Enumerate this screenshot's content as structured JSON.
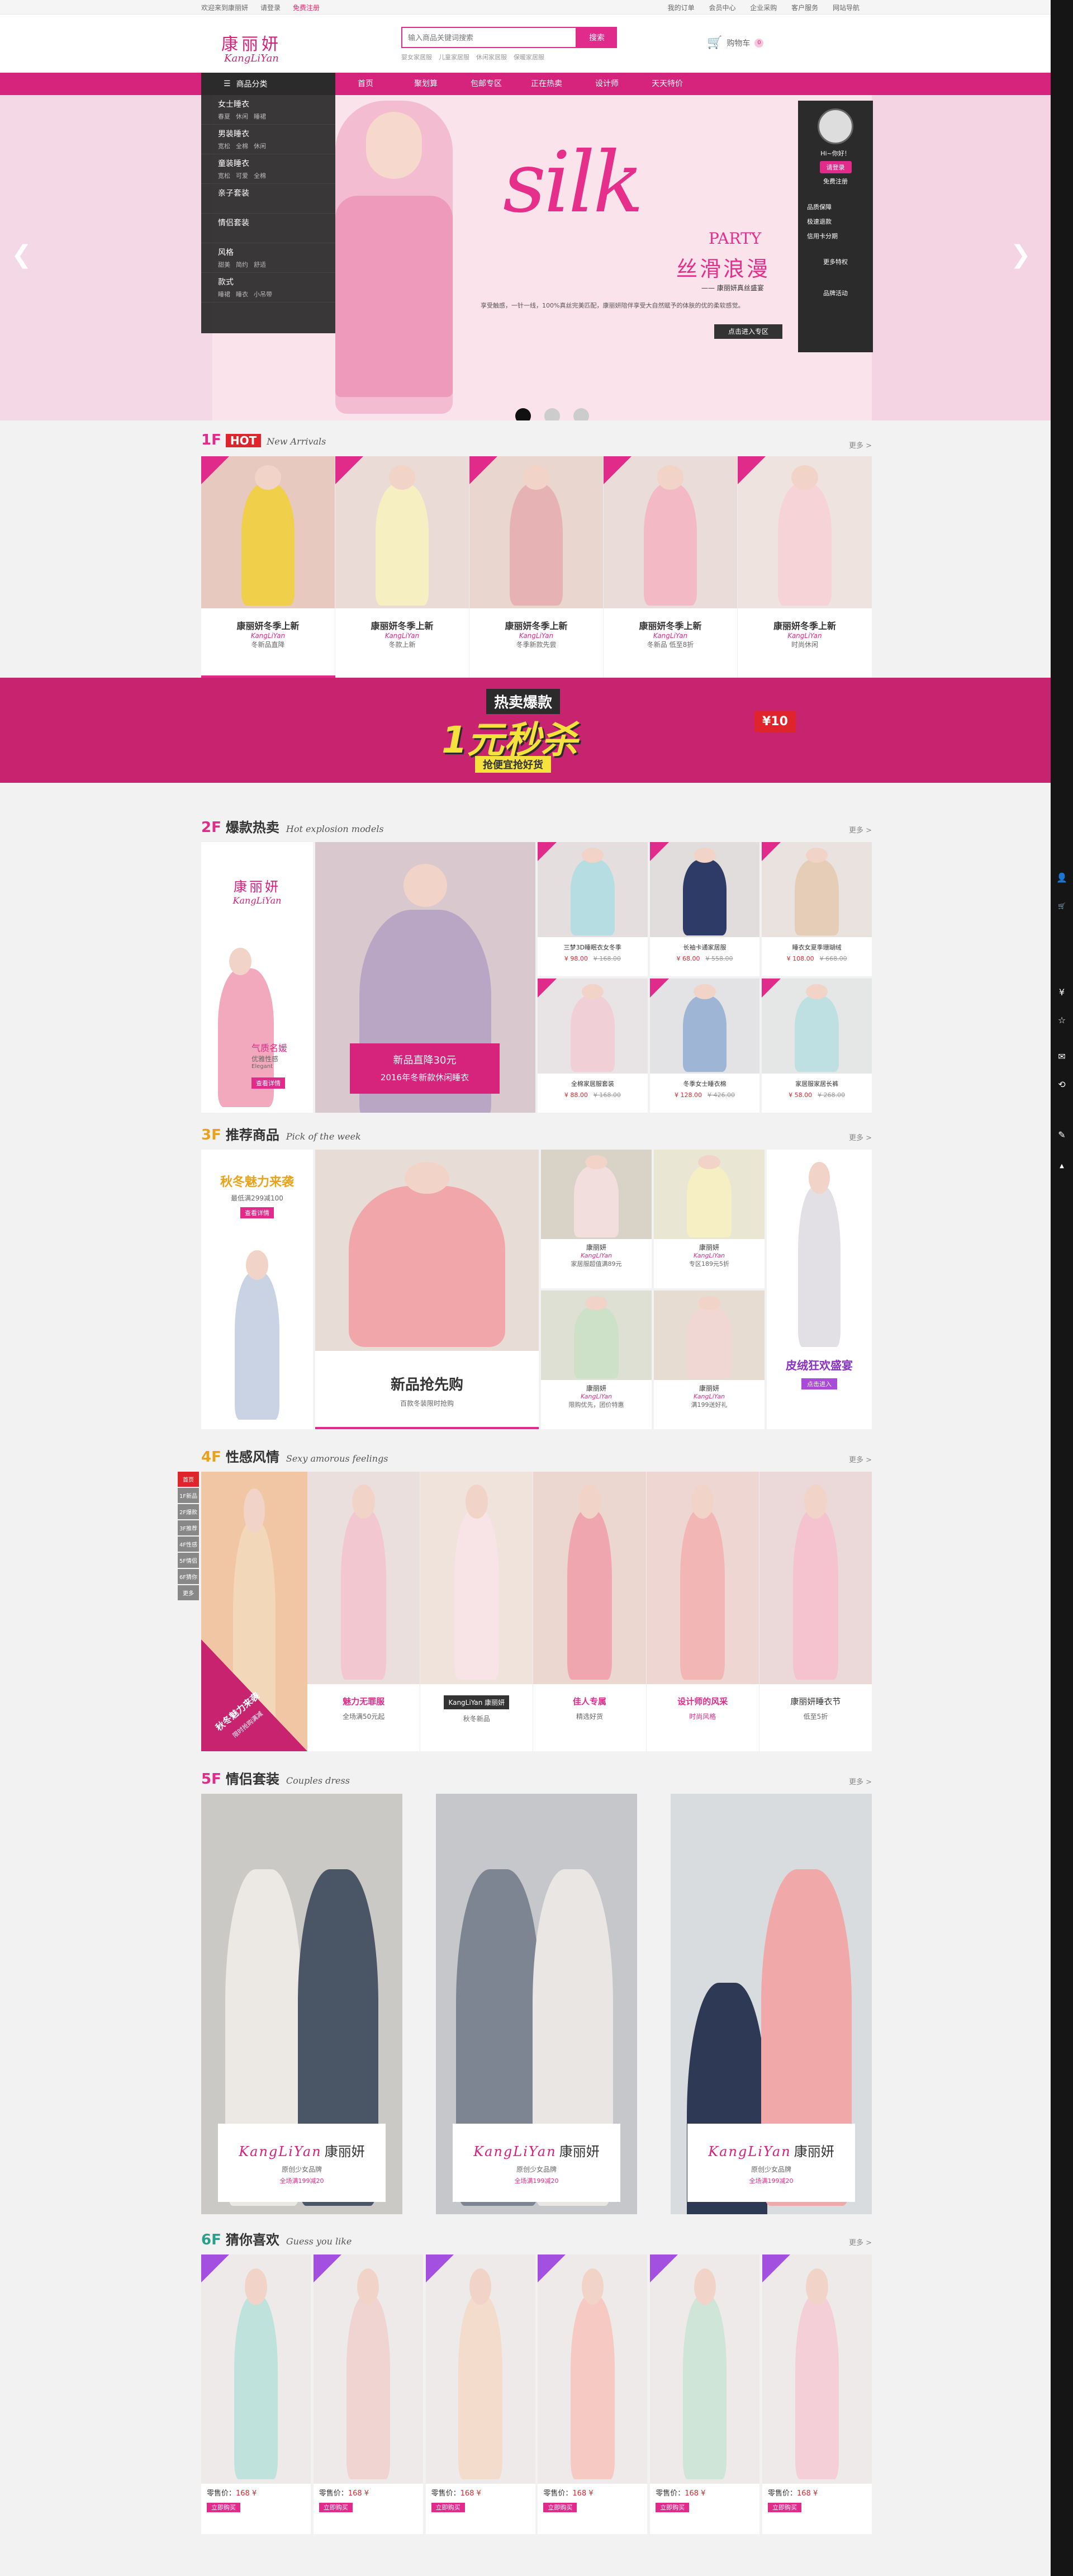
{
  "topbar": {
    "welcome": "欢迎来到康丽妍",
    "login": "请登录",
    "register": "免费注册",
    "links": [
      "我的订单",
      "会员中心",
      "企业采购",
      "客户服务",
      "网站导航"
    ]
  },
  "header": {
    "logo_cn": "康丽妍",
    "logo_en": "KangLiYan",
    "search_placeholder": "输入商品关键词搜索",
    "search_btn": "搜索",
    "hot": [
      "婴女家居服",
      "儿童家居服",
      "休闲家居服",
      "保暖家居服"
    ],
    "cart_label": "购物车",
    "cart_count": "0"
  },
  "nav": {
    "category": "商品分类",
    "items": [
      "首页",
      "聚划算",
      "包邮专区",
      "正在热卖",
      "设计师",
      "天天特价"
    ]
  },
  "catmenu": [
    {
      "t": "女士睡衣",
      "s": [
        "春夏",
        "休闲",
        "睡裙"
      ]
    },
    {
      "t": "男装睡衣",
      "s": [
        "宽松",
        "全棉",
        "休闲"
      ]
    },
    {
      "t": "童装睡衣",
      "s": [
        "宽松",
        "可爱",
        "全棉"
      ]
    },
    {
      "t": "亲子套装",
      "s": []
    },
    {
      "t": "情侣套装",
      "s": []
    },
    {
      "t": "风格",
      "s": [
        "甜美",
        "简约",
        "舒适"
      ]
    },
    {
      "t": "款式",
      "s": [
        "睡裙",
        "睡衣",
        "小吊带"
      ]
    }
  ],
  "banner": {
    "silk": "silk",
    "party": "PARTY",
    "title": "丝滑浪漫",
    "sub": "—— 康丽妍真丝盛宴",
    "desc": "享受触感，一针一线，100%真丝完美匹配，康丽妍陪伴享受大自然赋予的体肤的优的柔软感觉。",
    "enter": "点击进入专区"
  },
  "userpanel": {
    "hi": "Hi~你好！",
    "login": "请登录",
    "register": "免费注册",
    "links": [
      "品质保障",
      "极速退款",
      "信用卡分期"
    ],
    "more": "更多特权",
    "brand": "品牌活动"
  },
  "floor1": {
    "num": "1F",
    "hot": "HOT",
    "en": "New Arrivals",
    "more": "更多 >",
    "items": [
      {
        "title": "康丽妍冬季上新",
        "brand": "KangLiYan",
        "desc": "冬新品直降"
      },
      {
        "title": "康丽妍冬季上新",
        "brand": "KangLiYan",
        "desc": "冬款上新"
      },
      {
        "title": "康丽妍冬季上新",
        "brand": "KangLiYan",
        "desc": "冬季新款先尝"
      },
      {
        "title": "康丽妍冬季上新",
        "brand": "KangLiYan",
        "desc": "冬新品 低至8折"
      },
      {
        "title": "康丽妍冬季上新",
        "brand": "KangLiYan",
        "desc": "时尚休闲"
      }
    ]
  },
  "promo": {
    "top": "热卖爆款",
    "big": "1元秒杀",
    "bottom": "抢便宜抢好货",
    "tag": "¥10"
  },
  "floor2": {
    "num": "2F",
    "name": "爆款热卖",
    "en": "Hot explosion models",
    "more": "更多 >",
    "left": {
      "logo_cn": "康丽妍",
      "logo_en": "KangLiYan",
      "t1": "气质名媛",
      "t2": "优雅性感",
      "t3": "Elegant",
      "btn": "查看详情"
    },
    "mid": {
      "t1": "新品直降30元",
      "t2": "2016年冬新款休闲睡衣"
    },
    "items": [
      {
        "name": "三梦3D睡眠衣女冬季",
        "price": "¥ 98.00",
        "old": "¥ 168.00"
      },
      {
        "name": "长袖卡通家居服",
        "price": "¥ 68.00",
        "old": "¥ 558.00"
      },
      {
        "name": "睡衣女夏季珊瑚绒",
        "price": "¥ 108.00",
        "old": "¥ 668.00"
      },
      {
        "name": "全棉家居服套装",
        "price": "¥ 88.00",
        "old": "¥ 168.00"
      },
      {
        "name": "冬季女士睡衣棉",
        "price": "¥ 128.00",
        "old": "¥ 426.00"
      },
      {
        "name": "家居服家居长裤",
        "price": "¥ 58.00",
        "old": "¥ 268.00"
      }
    ]
  },
  "floor3": {
    "num": "3F",
    "name": "推荐商品",
    "en": "Pick of the week",
    "more": "更多 >",
    "left": {
      "t1": "秋冬魅力来袭",
      "t2": "最低满299减100",
      "btn": "查看详情"
    },
    "mid": {
      "t1": "新品抢先购",
      "t2": "百款冬装限时抢购"
    },
    "small": [
      {
        "t1": "康丽妍",
        "t2": "KangLiYan",
        "t3": "家居服超值满89元"
      },
      {
        "t1": "康丽妍",
        "t2": "KangLiYan",
        "t3": "专区189元5折"
      },
      {
        "t1": "康丽妍",
        "t2": "KangLiYan",
        "t3": "限购优先，团价特惠"
      },
      {
        "t1": "康丽妍",
        "t2": "KangLiYan",
        "t3": "满199送好礼"
      }
    ],
    "right": {
      "t1": "皮绒狂欢盛宴",
      "btn": "点击进入"
    }
  },
  "floor4": {
    "num": "4F",
    "name": "性感风情",
    "en": "Sexy amorous feelings",
    "more": "更多 >",
    "side": [
      "首页",
      "1F新品",
      "2F爆款",
      "3F推荐",
      "4F性感",
      "5F情侣",
      "6F猜你",
      "更多"
    ],
    "corner": "秋冬魅力来袭",
    "corner2": "限时抢购满减",
    "labels": [
      {
        "t1": "魅力无罪服",
        "t2": "全场满50元起"
      },
      {
        "t1": "KangLiYan 康丽妍",
        "t2": "秋冬新品"
      },
      {
        "t1": "佳人专属",
        "t2": "精选好货"
      },
      {
        "t1": "设计师的风采",
        "t2": "时尚风格"
      },
      {
        "t1": "康丽妍睡衣节",
        "t2": "低至5折"
      }
    ]
  },
  "floor5": {
    "num": "5F",
    "name": "情侣套装",
    "en": "Couples dress",
    "more": "更多 >",
    "cards": [
      {
        "brand": "KangLiYan",
        "cn": "康丽妍",
        "s": "原创少女品牌",
        "p": "全场满199减20"
      },
      {
        "brand": "KangLiYan",
        "cn": "康丽妍",
        "s": "原创少女品牌",
        "p": "全场满199减20"
      },
      {
        "brand": "KangLiYan",
        "cn": "康丽妍",
        "s": "原创少女品牌",
        "p": "全场满199减20"
      }
    ]
  },
  "floor6": {
    "num": "6F",
    "name": "猜你喜欢",
    "en": "Guess you like",
    "more": "更多 >",
    "price_label": "零售价：",
    "price": "168 ¥",
    "btn": "立即购买",
    "count": 6
  },
  "colors": {
    "brand": "#e02b8a",
    "nav": "#d6237c",
    "dark": "#2b2b2b"
  },
  "icons": [
    "search-icon",
    "cart-icon",
    "list-icon",
    "user-icon",
    "shield-icon",
    "refund-icon",
    "card-icon"
  ]
}
